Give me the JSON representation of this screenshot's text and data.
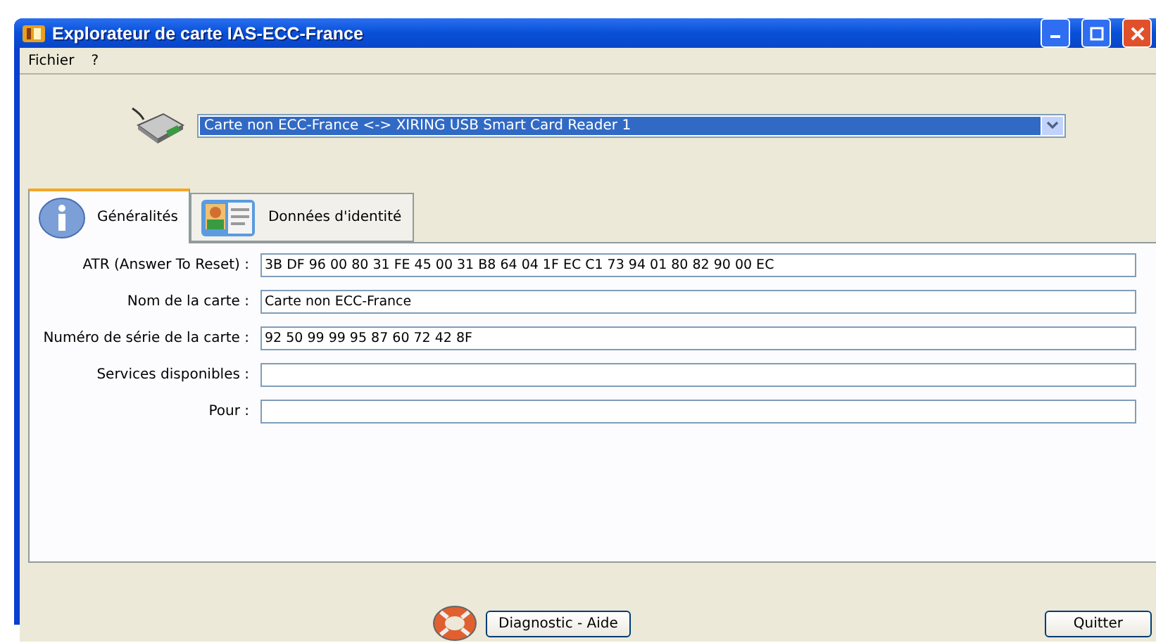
{
  "window": {
    "title": "Explorateur de carte IAS-ECC-France"
  },
  "menu": [
    "Fichier",
    "?"
  ],
  "reader_select": {
    "value": "Carte non ECC-France <-> XIRING USB Smart Card Reader 1"
  },
  "tabs": [
    {
      "label": "Généralités",
      "selected": true
    },
    {
      "label": "Données d'identité",
      "selected": false
    }
  ],
  "fields": [
    {
      "label": "ATR (Answer To Reset) :",
      "value": "3B DF 96 00 80 31 FE 45 00 31 B8 64 04 1F EC C1 73 94 01 80 82 90 00 EC"
    },
    {
      "label": "Nom de la carte :",
      "value": "Carte non ECC-France"
    },
    {
      "label": "Numéro de série de la carte :",
      "value": "92 50 99 99 95 87 60 72 42 8F"
    },
    {
      "label": "Services disponibles :"
    },
    {
      "label": "Pour :"
    }
  ],
  "buttons": {
    "help": "Diagnostic - Aide",
    "quit": "Quitter"
  }
}
